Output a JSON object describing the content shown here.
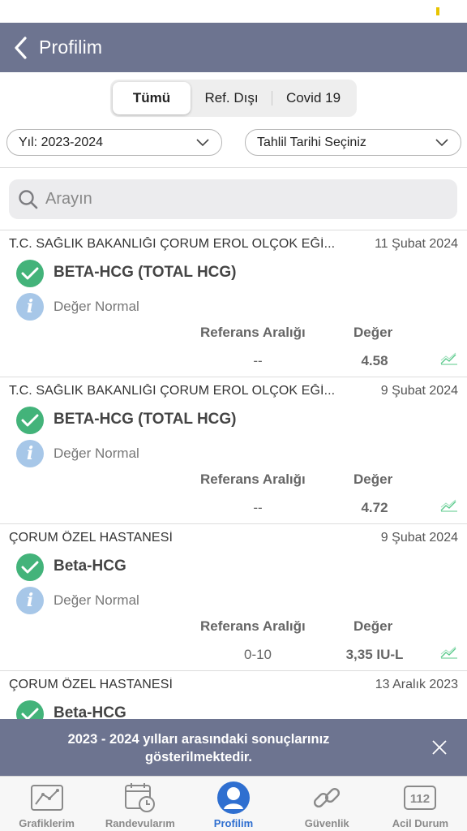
{
  "nav": {
    "title": "Profilim"
  },
  "segments": [
    {
      "label": "Tümü",
      "active": true
    },
    {
      "label": "Ref. Dışı",
      "active": false
    },
    {
      "label": "Covid 19",
      "active": false
    }
  ],
  "filters": {
    "year_label": "Yıl: 2023-2024",
    "date_label": "Tahlil Tarihi Seçiniz"
  },
  "search": {
    "placeholder": "Arayın"
  },
  "columns": {
    "ref_header": "Referans Aralığı",
    "value_header": "Değer"
  },
  "results": [
    {
      "hospital": "T.C. SAĞLIK BAKANLIĞI ÇORUM EROL OLÇOK EĞİ...",
      "date": "11 Şubat 2024",
      "test": "BETA-HCG (TOTAL HCG)",
      "status": "Değer Normal",
      "ref": "--",
      "value": "4.58"
    },
    {
      "hospital": "T.C. SAĞLIK BAKANLIĞI ÇORUM EROL OLÇOK EĞİ...",
      "date": "9 Şubat 2024",
      "test": "BETA-HCG (TOTAL HCG)",
      "status": "Değer Normal",
      "ref": "--",
      "value": "4.72"
    },
    {
      "hospital": "ÇORUM ÖZEL HASTANESİ",
      "date": "9 Şubat 2024",
      "test": "Beta-HCG",
      "status": "Değer Normal",
      "ref": "0-10",
      "value": "3,35 IU-L"
    },
    {
      "hospital": "ÇORUM ÖZEL HASTANESİ",
      "date": "13 Aralık 2023",
      "test": "Beta-HCG",
      "status": "",
      "ref": "",
      "value": ""
    }
  ],
  "toast": {
    "message": "2023 - 2024 yılları arasındaki sonuçlarınız gösterilmektedir."
  },
  "tabbar": {
    "items": [
      {
        "label": "Grafiklerim",
        "icon": "chart-icon"
      },
      {
        "label": "Randevularım",
        "icon": "calendar-clock-icon"
      },
      {
        "label": "Profilim",
        "icon": "profile-icon",
        "active": true
      },
      {
        "label": "Güvenlik",
        "icon": "link-icon"
      },
      {
        "label": "Acil Durum",
        "icon": "emergency-112-icon",
        "badge": "112"
      }
    ]
  },
  "colors": {
    "header": "#6d7490",
    "check": "#43b37a",
    "info": "#a7c7e8",
    "active_tab": "#2f6fd0",
    "trend": "#58c98a"
  }
}
